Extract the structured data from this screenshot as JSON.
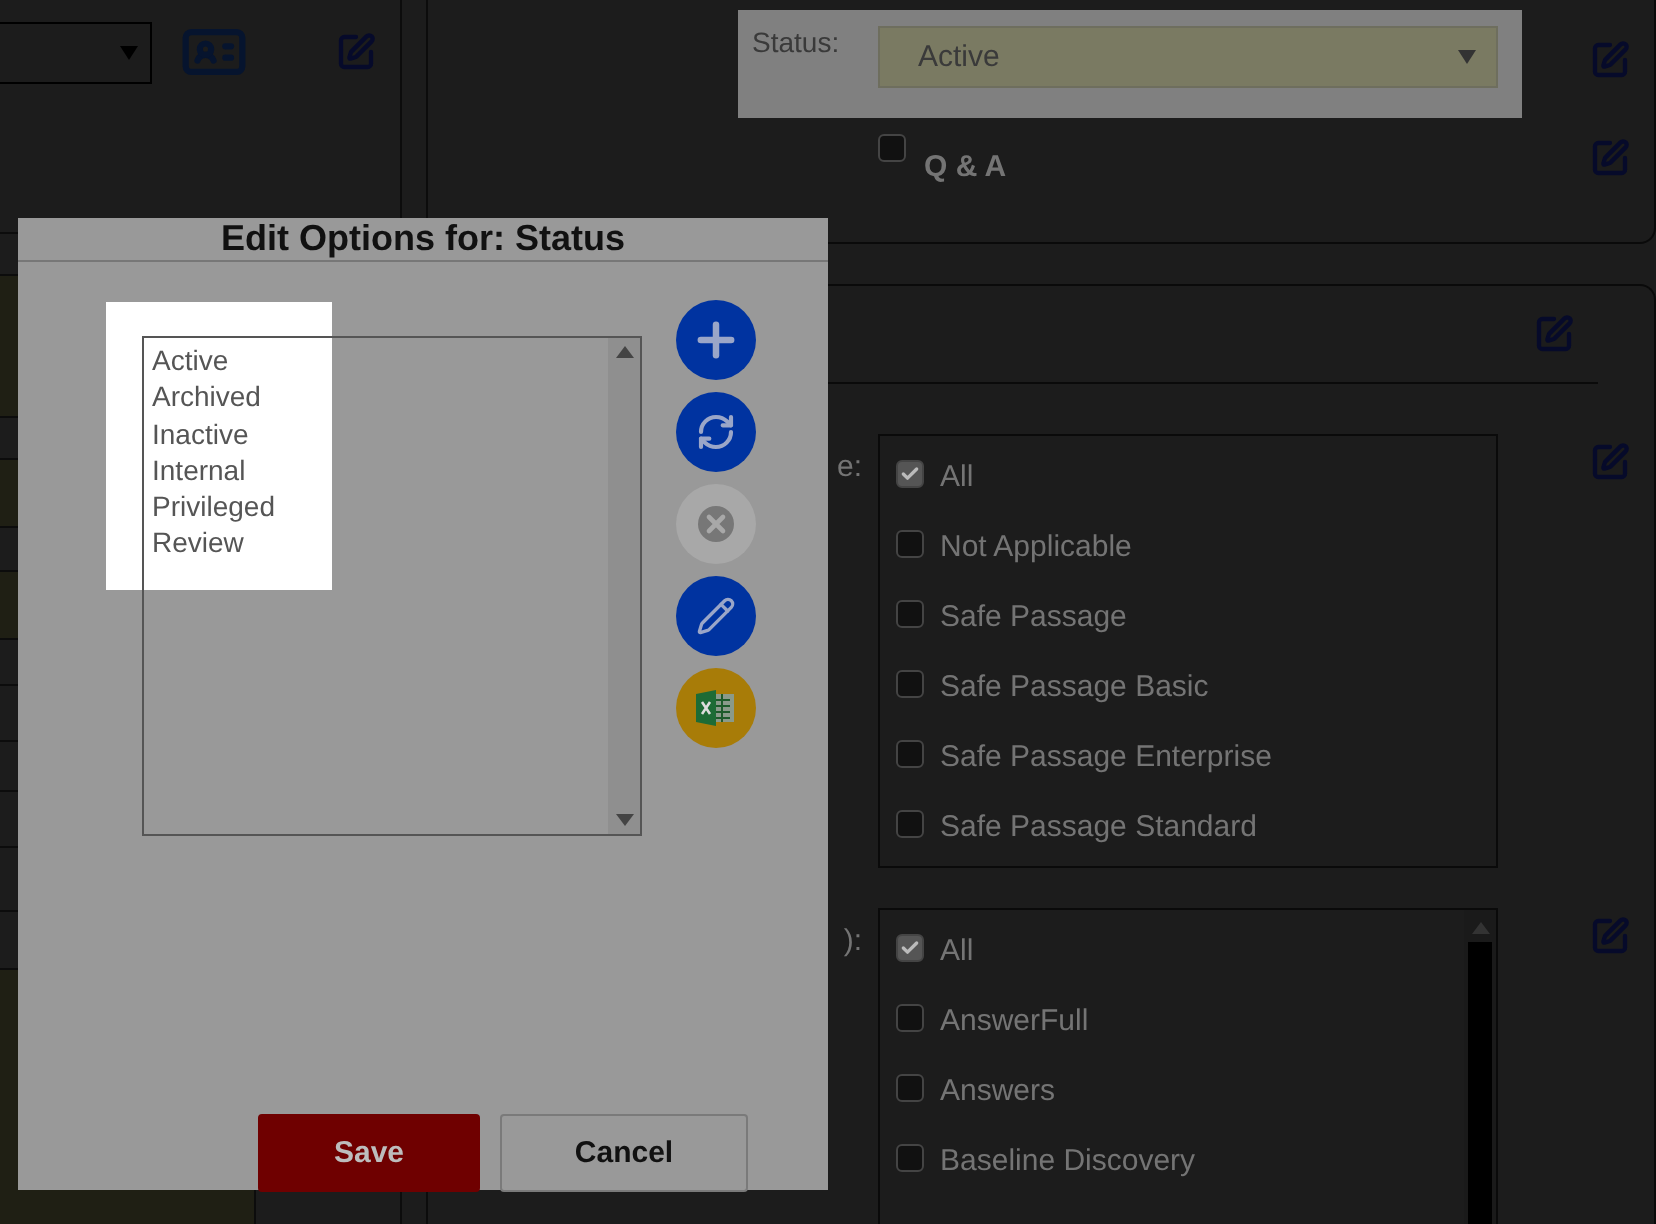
{
  "background": {
    "status_field": {
      "label": "Status:",
      "value": "Active"
    },
    "qa_checkbox": {
      "label": "Q & A",
      "checked": false
    },
    "field_groups": [
      {
        "label": "e:",
        "scrollable": false,
        "options": [
          {
            "label": "All",
            "checked": true
          },
          {
            "label": "Not Applicable",
            "checked": false
          },
          {
            "label": "Safe Passage",
            "checked": false
          },
          {
            "label": "Safe Passage Basic",
            "checked": false
          },
          {
            "label": "Safe Passage Enterprise",
            "checked": false
          },
          {
            "label": "Safe Passage Standard",
            "checked": false
          }
        ]
      },
      {
        "label": "):",
        "scrollable": true,
        "options": [
          {
            "label": "All",
            "checked": true
          },
          {
            "label": "AnswerFull",
            "checked": false
          },
          {
            "label": "Answers",
            "checked": false
          },
          {
            "label": "Baseline Discovery",
            "checked": false
          }
        ]
      }
    ]
  },
  "dialog": {
    "title": "Edit Options for: Status",
    "options": [
      {
        "label": "Active",
        "selected": false
      },
      {
        "label": "Archived",
        "selected": false
      },
      {
        "label": "Inactive",
        "selected": false
      },
      {
        "label": "Internal",
        "selected": false
      },
      {
        "label": "Privileged",
        "selected": false
      },
      {
        "label": "Review",
        "selected": false
      }
    ],
    "action_buttons": [
      {
        "kind": "add",
        "disabled": false
      },
      {
        "kind": "refresh",
        "disabled": false
      },
      {
        "kind": "delete",
        "disabled": true
      },
      {
        "kind": "edit",
        "disabled": false
      },
      {
        "kind": "excel",
        "disabled": false
      }
    ],
    "buttons": [
      {
        "label": "Save",
        "kind": "primary"
      },
      {
        "label": "Cancel",
        "kind": "secondary"
      }
    ]
  }
}
